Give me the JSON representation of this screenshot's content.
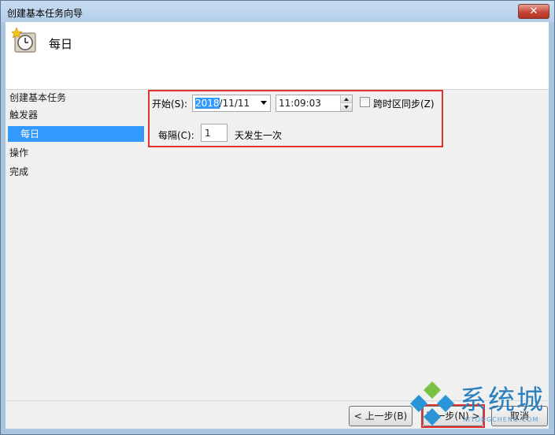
{
  "window": {
    "title": "创建基本任务向导",
    "close_glyph": "✕"
  },
  "header": {
    "title": "每日",
    "icon": "clock-icon"
  },
  "sidebar": {
    "items": [
      {
        "label": "创建基本任务"
      },
      {
        "label": "触发器"
      },
      {
        "label": "每日",
        "selected": true
      },
      {
        "label": "操作"
      },
      {
        "label": "完成"
      }
    ]
  },
  "form": {
    "start_label": "开始(S):",
    "date_year": "2018",
    "date_rest": "/11/11",
    "time_value": "11:09:03",
    "sync_label": "跨时区同步(Z)",
    "sync_checked": false,
    "every_label": "每隔(C):",
    "every_value": "1",
    "every_suffix": "天发生一次"
  },
  "footer": {
    "back_label": "< 上一步(B)",
    "next_label": "下一步(N) >",
    "cancel_label": "取消"
  },
  "watermark": {
    "text": "系统城",
    "sub": "XITONGCHENG.COM"
  },
  "colors": {
    "selection": "#3399ff",
    "highlight": "#e03030",
    "watermark": "#2a7fbf"
  }
}
